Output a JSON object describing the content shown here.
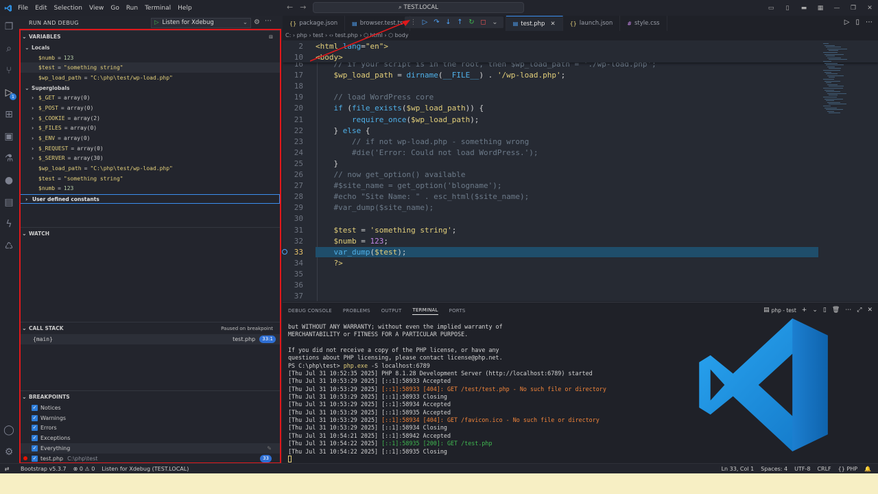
{
  "menu": [
    "File",
    "Edit",
    "Selection",
    "View",
    "Go",
    "Run",
    "Terminal",
    "Help"
  ],
  "command_center": "TEST.LOCAL",
  "sidebar": {
    "title": "RUN AND DEBUG",
    "config_select": "Listen for Xdebug",
    "variables": {
      "title": "VARIABLES",
      "locals_label": "Locals",
      "locals": [
        {
          "name": "$numb",
          "value": "123"
        },
        {
          "name": "$test",
          "value": "\"something string\""
        },
        {
          "name": "$wp_load_path",
          "value": "\"C:\\php\\test/wp-load.php\""
        }
      ],
      "superglobals_label": "Superglobals",
      "superglobals": [
        {
          "name": "$_GET",
          "value": "array(0)"
        },
        {
          "name": "$_POST",
          "value": "array(0)"
        },
        {
          "name": "$_COOKIE",
          "value": "array(2)"
        },
        {
          "name": "$_FILES",
          "value": "array(0)"
        },
        {
          "name": "$_ENV",
          "value": "array(0)"
        },
        {
          "name": "$_REQUEST",
          "value": "array(0)"
        },
        {
          "name": "$_SERVER",
          "value": "array(30)"
        }
      ],
      "superglobal_leaves": [
        {
          "name": "$wp_load_path",
          "value": "\"C:\\php\\test/wp-load.php\""
        },
        {
          "name": "$test",
          "value": "\"something string\""
        },
        {
          "name": "$numb",
          "value": "123"
        }
      ],
      "user_defined": "User defined constants"
    },
    "watch": {
      "title": "WATCH"
    },
    "call_stack": {
      "title": "CALL STACK",
      "status": "Paused on breakpoint",
      "frame": "{main}",
      "file": "test.php",
      "pos": "33:1"
    },
    "breakpoints": {
      "title": "BREAKPOINTS",
      "items": [
        "Notices",
        "Warnings",
        "Errors",
        "Exceptions",
        "Everything"
      ],
      "file": {
        "name": "test.php",
        "path": "C:\\php\\test",
        "line": "33"
      }
    }
  },
  "tabs": [
    {
      "label": "package.json",
      "icon": "{}"
    },
    {
      "label": "browser.test.ts",
      "icon": "▤"
    },
    {
      "label": "ttings",
      "icon": ""
    },
    {
      "label": "test.php",
      "icon": "▤"
    },
    {
      "label": "launch.json",
      "icon": "{}"
    },
    {
      "label": "style.css",
      "icon": "#"
    }
  ],
  "breadcrumb": "C: › php › test › ‹› test.php › ⬡ html › ⬡ body",
  "editor": {
    "sticky": [
      {
        "n": "2",
        "html": "<span class='tag'>&lt;html</span> <span class='attr'>lang</span>=<span class='str'>\"en\"</span><span class='tag'>&gt;</span>"
      },
      {
        "n": "10",
        "html": "<span class='tag'>&lt;body&gt;</span>"
      }
    ],
    "lines": [
      {
        "n": "16",
        "html": "<span class='cmt'>    // if your script is in the root, then $wp_load_path = './wp-load.php';</span>"
      },
      {
        "n": "17",
        "html": "    <span class='var'>$wp_load_path</span> = <span class='fn'>dirname</span>(<span class='con'>__FILE__</span>) . <span class='str'>'/wp-load.php'</span>;"
      },
      {
        "n": "18",
        "html": ""
      },
      {
        "n": "19",
        "html": "<span class='cmt'>    // load WordPress core</span>"
      },
      {
        "n": "20",
        "html": "    <span class='kw'>if</span> (<span class='fn'>file_exists</span>(<span class='var'>$wp_load_path</span>)) {"
      },
      {
        "n": "21",
        "html": "        <span class='kw'>require_once</span>(<span class='var'>$wp_load_path</span>);"
      },
      {
        "n": "22",
        "html": "    } <span class='kw'>else</span> {"
      },
      {
        "n": "23",
        "html": "<span class='cmt'>        // if not wp-load.php - something wrong</span>"
      },
      {
        "n": "24",
        "html": "<span class='cmt'>        #die('Error: Could not load WordPress.');</span>"
      },
      {
        "n": "25",
        "html": "    }"
      },
      {
        "n": "26",
        "html": "<span class='cmt'>    // now get_option() available</span>"
      },
      {
        "n": "27",
        "html": "<span class='cmt'>    #$site_name = get_option('blogname');</span>"
      },
      {
        "n": "28",
        "html": "<span class='cmt'>    #echo \"Site Name: \" . esc_html($site_name);</span>"
      },
      {
        "n": "29",
        "html": "<span class='cmt'>    #var_dump($site_name);</span>"
      },
      {
        "n": "30",
        "html": ""
      },
      {
        "n": "31",
        "html": "    <span class='var'>$test</span> = <span class='str'>'something string'</span>;"
      },
      {
        "n": "32",
        "html": "    <span class='var'>$numb</span> = <span class='num'>123</span>;"
      },
      {
        "n": "33",
        "html": "    <span class='fn'>var_dump</span>(<span class='var'>$test</span>);"
      },
      {
        "n": "34",
        "html": "    <span class='tag'>?&gt;</span>"
      },
      {
        "n": "35",
        "html": ""
      },
      {
        "n": "36",
        "html": ""
      },
      {
        "n": "37",
        "html": ""
      }
    ],
    "current_line": "33"
  },
  "panel": {
    "tabs": [
      "DEBUG CONSOLE",
      "PROBLEMS",
      "OUTPUT",
      "TERMINAL",
      "PORTS"
    ],
    "active": "TERMINAL",
    "terminal_name": "php - test",
    "lines": [
      {
        "t": "but WITHOUT ANY WARRANTY; without even the implied warranty of",
        "c": ""
      },
      {
        "t": "MERCHANTABILITY or FITNESS FOR A PARTICULAR PURPOSE.",
        "c": ""
      },
      {
        "t": "",
        "c": ""
      },
      {
        "t": "If you did not receive a copy of the PHP license, or have any",
        "c": ""
      },
      {
        "t": "questions about PHP licensing, please contact license@php.net.",
        "c": ""
      },
      {
        "t": "PS C:\\php\\test> ",
        "c": "",
        "cmd": "php.exe",
        "rest": " -S localhost:6789"
      },
      {
        "t": "[Thu Jul 31 10:52:35 2025] PHP 8.1.28 Development Server (http://localhost:6789) started",
        "c": ""
      },
      {
        "t": "[Thu Jul 31 10:53:29 2025] [::1]:58933 Accepted",
        "c": ""
      },
      {
        "t": "[Thu Jul 31 10:53:29 2025] ",
        "c": "",
        "hl": "[::1]:58933 [404]: GET /test/test.php - No such file or directory",
        "hc": "t-err"
      },
      {
        "t": "[Thu Jul 31 10:53:29 2025] [::1]:58933 Closing",
        "c": ""
      },
      {
        "t": "[Thu Jul 31 10:53:29 2025] [::1]:58934 Accepted",
        "c": ""
      },
      {
        "t": "[Thu Jul 31 10:53:29 2025] [::1]:58935 Accepted",
        "c": ""
      },
      {
        "t": "[Thu Jul 31 10:53:29 2025] ",
        "c": "",
        "hl": "[::1]:58934 [404]: GET /favicon.ico - No such file or directory",
        "hc": "t-err"
      },
      {
        "t": "[Thu Jul 31 10:53:29 2025] [::1]:58934 Closing",
        "c": ""
      },
      {
        "t": "[Thu Jul 31 10:54:21 2025] [::1]:58942 Accepted",
        "c": ""
      },
      {
        "t": "[Thu Jul 31 10:54:22 2025] ",
        "c": "",
        "hl": "[::1]:58935 [200]: GET /test.php",
        "hc": "t-ok"
      },
      {
        "t": "[Thu Jul 31 10:54:22 2025] [::1]:58935 Closing",
        "c": ""
      }
    ]
  },
  "status": {
    "left": [
      "Bootstrap v5.3.7",
      "⊗ 0 ⚠ 0",
      "Listen for Xdebug (TEST.LOCAL)"
    ],
    "right": [
      "Ln 33, Col 1",
      "Spaces: 4",
      "UTF-8",
      "CRLF",
      "{} PHP"
    ]
  },
  "colors": {
    "accent": "#3b8ff0",
    "highlight_frame": "#e0181b",
    "current_line": "#1f4e6b"
  }
}
